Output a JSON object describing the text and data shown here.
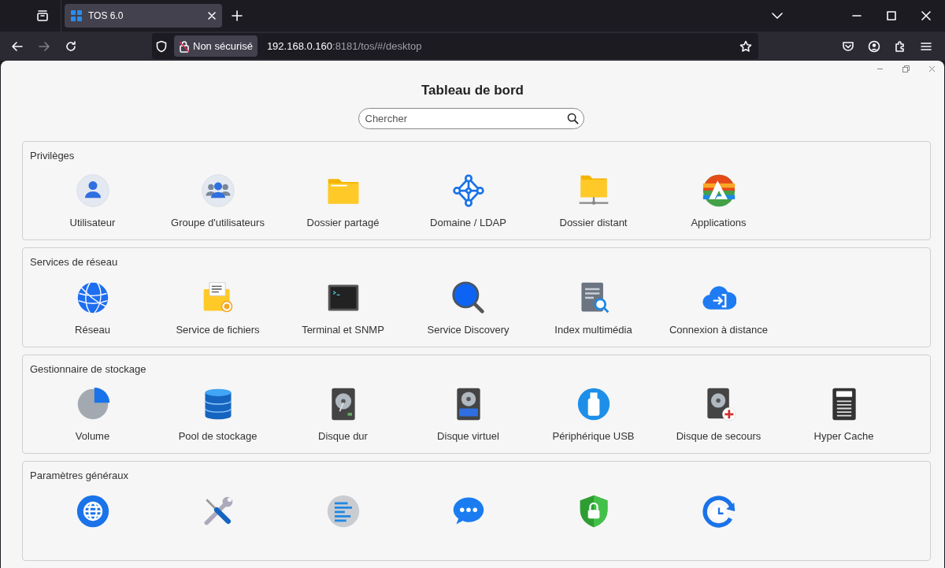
{
  "browser": {
    "tab": {
      "title": "TOS 6.0",
      "selected": true
    },
    "back_disabled": false,
    "forward_disabled": true,
    "security": "Non sécurisé",
    "url_host": "192.168.0.160",
    "url_rest": ":8181/tos/#/desktop"
  },
  "title": "Tableau de bord",
  "search": {
    "placeholder": "Chercher"
  },
  "sections": [
    {
      "title": "Privilèges",
      "items": [
        {
          "label": "Utilisateur",
          "kind": "user"
        },
        {
          "label": "Groupe d'utilisateurs",
          "kind": "group"
        },
        {
          "label": "Dossier partagé",
          "kind": "folder"
        },
        {
          "label": "Domaine / LDAP",
          "kind": "domain"
        },
        {
          "label": "Dossier distant",
          "kind": "remote"
        },
        {
          "label": "Applications",
          "kind": "apps"
        }
      ]
    },
    {
      "title": "Services de réseau",
      "items": [
        {
          "label": "Réseau",
          "kind": "network"
        },
        {
          "label": "Service de fichiers",
          "kind": "fileservice"
        },
        {
          "label": "Terminal et SNMP",
          "kind": "terminal"
        },
        {
          "label": "Service Discovery",
          "kind": "discovery"
        },
        {
          "label": "Index multimédia",
          "kind": "media"
        },
        {
          "label": "Connexion à distance",
          "kind": "cloud"
        }
      ]
    },
    {
      "title": "Gestionnaire de stockage",
      "items": [
        {
          "label": "Volume",
          "kind": "pie"
        },
        {
          "label": "Pool de stockage",
          "kind": "database"
        },
        {
          "label": "Disque dur",
          "kind": "hdd"
        },
        {
          "label": "Disque virtuel",
          "kind": "vhd"
        },
        {
          "label": "Périphérique USB",
          "kind": "usb"
        },
        {
          "label": "Disque de secours",
          "kind": "hddplus"
        },
        {
          "label": "Hyper Cache",
          "kind": "ssd"
        }
      ]
    },
    {
      "title": "Paramètres généraux",
      "items": [
        {
          "kind": "globe"
        },
        {
          "kind": "tools"
        },
        {
          "kind": "bars"
        },
        {
          "kind": "chat"
        },
        {
          "kind": "shield"
        },
        {
          "kind": "clock"
        }
      ]
    }
  ]
}
